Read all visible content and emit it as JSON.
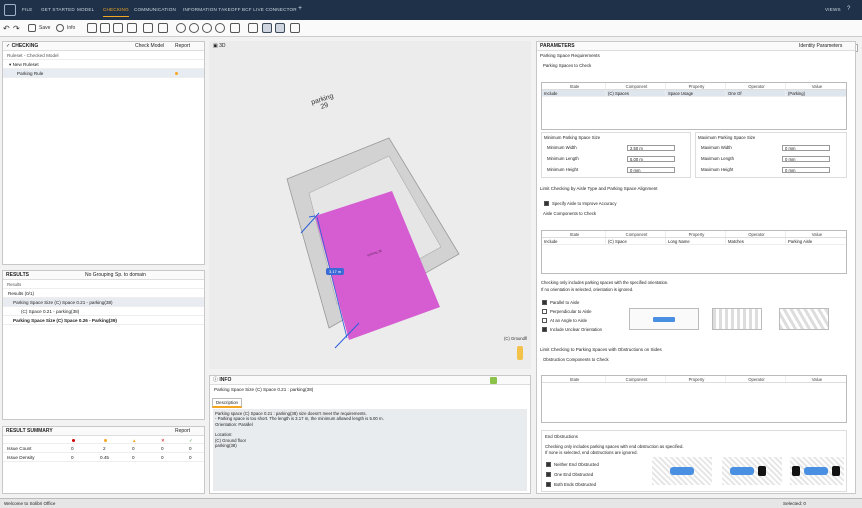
{
  "menu": {
    "tabs": [
      "FILE",
      "GET STARTED",
      "MODEL",
      "CHECKING",
      "COMMUNICATION",
      "INFORMATION TAKEOFF",
      "BCF LIVE CONNECTOR"
    ],
    "active": "CHECKING",
    "views": "VIEWS"
  },
  "toolbar": {
    "save": "Save",
    "info": "Info",
    "search_placeholder": "Search"
  },
  "checking": {
    "title": "CHECKING",
    "check_model": "Check Model",
    "report": "Report",
    "ruleset": "Ruleset - Checked Model",
    "rows": [
      "New Ruleset",
      "Parking Rule"
    ]
  },
  "results": {
    "title": "RESULTS",
    "grouping": "No Grouping",
    "sort": "Sp. to domain",
    "items": [
      "Results (0/1)",
      "Parking Space Size (C) Space 0.21 - parking(38)",
      "(C) Space 0.21 - parking(38)",
      "Parking Space Size (C) Space 0.26 - Parking(39)"
    ]
  },
  "summary": {
    "title": "RESULT SUMMARY",
    "report": "Report",
    "rows": [
      {
        "label": "Issue Count",
        "values": [
          "0",
          "2",
          "0",
          "0",
          "0"
        ]
      },
      {
        "label": "Issue Density",
        "values": [
          "0",
          "0.45",
          "0",
          "0",
          "0"
        ]
      }
    ],
    "colors": [
      "#cc0000",
      "#f5a623",
      "#f5a623",
      "#cc0000",
      "#3a9a3a"
    ]
  },
  "view": {
    "title": "3D",
    "parking_label": "parking\n29",
    "floor_label": "parking 38",
    "measure": "3.17 m",
    "ground_label": "(C) Groundfl"
  },
  "info": {
    "title": "INFO",
    "subject": "Parking Space Size (C) Space 0.21 : parking(38)",
    "tab": "Description",
    "text": [
      "Parking space (C) Space 0.21 : parking(38) size doesn't meet the requirements.",
      "- Parking space is too short. The length is 3.17 m, the minimum allowed length is 5.00 m.",
      "Orientation: Parallel",
      "",
      "Location:",
      "(C) Ground floor",
      "parking(38)"
    ]
  },
  "params": {
    "title": "PARAMETERS",
    "identity": "Identity Parameters",
    "section1": "Parking Space Requirements",
    "spaces_to_check": "Parking Spaces to Check",
    "cols": [
      "State",
      "Component",
      "Property",
      "Operator",
      "Value"
    ],
    "row1": [
      "Include",
      "(C) Spaces",
      "Space Usage",
      "One Of",
      "(Parking)"
    ],
    "min_size": "Minimum Parking Space Size",
    "max_size": "Maximum Parking Space Size",
    "min_fields": [
      [
        "Minimum Width",
        "2.50 m"
      ],
      [
        "Minimum Length",
        "5.00 m"
      ],
      [
        "Minimum Height",
        "0 mm"
      ]
    ],
    "max_fields": [
      [
        "Maximum Width",
        "0 mm"
      ],
      [
        "Maximum Length",
        "0 mm"
      ],
      [
        "Maximum Height",
        "0 mm"
      ]
    ],
    "limit_axis": "Limit Checking by Aisle Type and Parking Space Alignment",
    "specify_axis": "Specify Aisle to Improve Accuracy",
    "aisle_components": "Aisle Components to Check",
    "row2": [
      "Include",
      "(C) Space",
      "Long Name",
      "Matches",
      "Parking Aisle"
    ],
    "aisle_note1": "Checking only includes parking spaces with the specified orientation.",
    "aisle_note2": "If no orientation is selected, orientation is ignored.",
    "orientations": [
      [
        "Parallel to Aisle",
        true
      ],
      [
        "Perpendicular to Aisle",
        false
      ],
      [
        "At an Angle to Aisle",
        false
      ],
      [
        "Include Unclear Orientation",
        true
      ]
    ],
    "limit_obs": "Limit Checking to Parking Spaces with Obstructions on Sides",
    "obs_components": "Obstruction Components to Check",
    "end_obs": "End Obstructions",
    "end_note1": "Checking only includes parking spaces with end obstruction as specified.",
    "end_note2": "If none is selected, end obstructions are ignored.",
    "end_options": [
      "Neither End Obstructed",
      "One End Obstructed",
      "Both Ends Obstructed"
    ]
  },
  "status": {
    "left": "Welcome to Solibri Office",
    "right": "Selected: 0"
  }
}
